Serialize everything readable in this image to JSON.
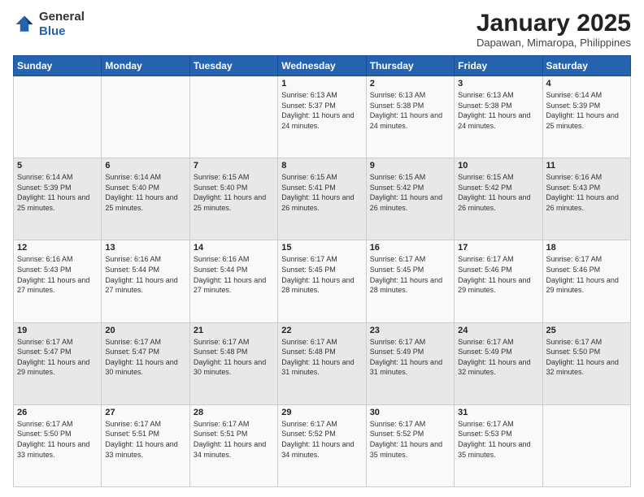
{
  "header": {
    "logo_general": "General",
    "logo_blue": "Blue",
    "title": "January 2025",
    "subtitle": "Dapawan, Mimaropa, Philippines"
  },
  "weekdays": [
    "Sunday",
    "Monday",
    "Tuesday",
    "Wednesday",
    "Thursday",
    "Friday",
    "Saturday"
  ],
  "weeks": [
    [
      {
        "day": "",
        "sunrise": "",
        "sunset": "",
        "daylight": ""
      },
      {
        "day": "",
        "sunrise": "",
        "sunset": "",
        "daylight": ""
      },
      {
        "day": "",
        "sunrise": "",
        "sunset": "",
        "daylight": ""
      },
      {
        "day": "1",
        "sunrise": "6:13 AM",
        "sunset": "5:37 PM",
        "daylight": "11 hours and 24 minutes."
      },
      {
        "day": "2",
        "sunrise": "6:13 AM",
        "sunset": "5:38 PM",
        "daylight": "11 hours and 24 minutes."
      },
      {
        "day": "3",
        "sunrise": "6:13 AM",
        "sunset": "5:38 PM",
        "daylight": "11 hours and 24 minutes."
      },
      {
        "day": "4",
        "sunrise": "6:14 AM",
        "sunset": "5:39 PM",
        "daylight": "11 hours and 25 minutes."
      }
    ],
    [
      {
        "day": "5",
        "sunrise": "6:14 AM",
        "sunset": "5:39 PM",
        "daylight": "11 hours and 25 minutes."
      },
      {
        "day": "6",
        "sunrise": "6:14 AM",
        "sunset": "5:40 PM",
        "daylight": "11 hours and 25 minutes."
      },
      {
        "day": "7",
        "sunrise": "6:15 AM",
        "sunset": "5:40 PM",
        "daylight": "11 hours and 25 minutes."
      },
      {
        "day": "8",
        "sunrise": "6:15 AM",
        "sunset": "5:41 PM",
        "daylight": "11 hours and 26 minutes."
      },
      {
        "day": "9",
        "sunrise": "6:15 AM",
        "sunset": "5:42 PM",
        "daylight": "11 hours and 26 minutes."
      },
      {
        "day": "10",
        "sunrise": "6:15 AM",
        "sunset": "5:42 PM",
        "daylight": "11 hours and 26 minutes."
      },
      {
        "day": "11",
        "sunrise": "6:16 AM",
        "sunset": "5:43 PM",
        "daylight": "11 hours and 26 minutes."
      }
    ],
    [
      {
        "day": "12",
        "sunrise": "6:16 AM",
        "sunset": "5:43 PM",
        "daylight": "11 hours and 27 minutes."
      },
      {
        "day": "13",
        "sunrise": "6:16 AM",
        "sunset": "5:44 PM",
        "daylight": "11 hours and 27 minutes."
      },
      {
        "day": "14",
        "sunrise": "6:16 AM",
        "sunset": "5:44 PM",
        "daylight": "11 hours and 27 minutes."
      },
      {
        "day": "15",
        "sunrise": "6:17 AM",
        "sunset": "5:45 PM",
        "daylight": "11 hours and 28 minutes."
      },
      {
        "day": "16",
        "sunrise": "6:17 AM",
        "sunset": "5:45 PM",
        "daylight": "11 hours and 28 minutes."
      },
      {
        "day": "17",
        "sunrise": "6:17 AM",
        "sunset": "5:46 PM",
        "daylight": "11 hours and 29 minutes."
      },
      {
        "day": "18",
        "sunrise": "6:17 AM",
        "sunset": "5:46 PM",
        "daylight": "11 hours and 29 minutes."
      }
    ],
    [
      {
        "day": "19",
        "sunrise": "6:17 AM",
        "sunset": "5:47 PM",
        "daylight": "11 hours and 29 minutes."
      },
      {
        "day": "20",
        "sunrise": "6:17 AM",
        "sunset": "5:47 PM",
        "daylight": "11 hours and 30 minutes."
      },
      {
        "day": "21",
        "sunrise": "6:17 AM",
        "sunset": "5:48 PM",
        "daylight": "11 hours and 30 minutes."
      },
      {
        "day": "22",
        "sunrise": "6:17 AM",
        "sunset": "5:48 PM",
        "daylight": "11 hours and 31 minutes."
      },
      {
        "day": "23",
        "sunrise": "6:17 AM",
        "sunset": "5:49 PM",
        "daylight": "11 hours and 31 minutes."
      },
      {
        "day": "24",
        "sunrise": "6:17 AM",
        "sunset": "5:49 PM",
        "daylight": "11 hours and 32 minutes."
      },
      {
        "day": "25",
        "sunrise": "6:17 AM",
        "sunset": "5:50 PM",
        "daylight": "11 hours and 32 minutes."
      }
    ],
    [
      {
        "day": "26",
        "sunrise": "6:17 AM",
        "sunset": "5:50 PM",
        "daylight": "11 hours and 33 minutes."
      },
      {
        "day": "27",
        "sunrise": "6:17 AM",
        "sunset": "5:51 PM",
        "daylight": "11 hours and 33 minutes."
      },
      {
        "day": "28",
        "sunrise": "6:17 AM",
        "sunset": "5:51 PM",
        "daylight": "11 hours and 34 minutes."
      },
      {
        "day": "29",
        "sunrise": "6:17 AM",
        "sunset": "5:52 PM",
        "daylight": "11 hours and 34 minutes."
      },
      {
        "day": "30",
        "sunrise": "6:17 AM",
        "sunset": "5:52 PM",
        "daylight": "11 hours and 35 minutes."
      },
      {
        "day": "31",
        "sunrise": "6:17 AM",
        "sunset": "5:53 PM",
        "daylight": "11 hours and 35 minutes."
      },
      {
        "day": "",
        "sunrise": "",
        "sunset": "",
        "daylight": ""
      }
    ]
  ]
}
